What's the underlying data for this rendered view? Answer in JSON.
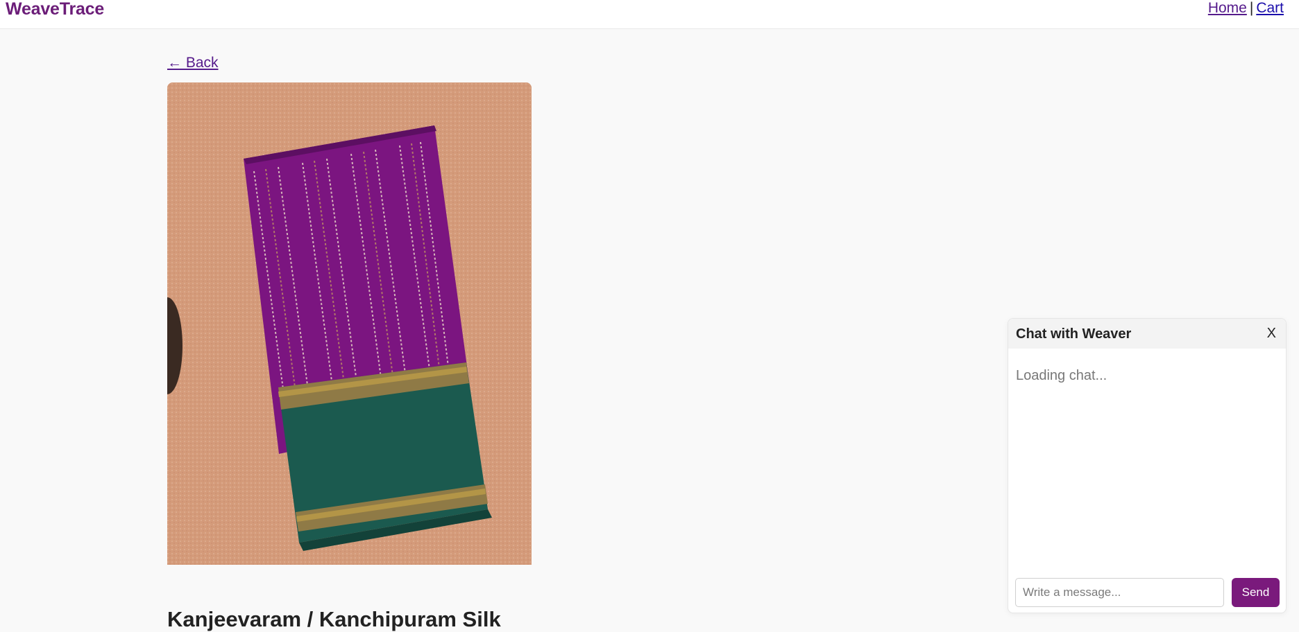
{
  "brand": {
    "name": "WeaveTrace"
  },
  "nav": {
    "home": "Home",
    "separator": "|",
    "cart": "Cart"
  },
  "page": {
    "back_label": "← Back",
    "product_title": "Kanjeevaram / Kanchipuram Silk"
  },
  "product_image": {
    "subject": "folded silk saree",
    "colors": {
      "body": "#7b1580",
      "border": "#1b5a4f",
      "zari": "#b39547",
      "background": "#d49b7a"
    }
  },
  "chat": {
    "title": "Chat with Weaver",
    "close_label": "X",
    "status": "Loading chat...",
    "input_placeholder": "Write a message...",
    "send_label": "Send"
  },
  "colors": {
    "brand": "#6b1d78",
    "accent": "#7a1a7c",
    "link": "#1a0dab",
    "link_visited": "#551a8b"
  }
}
